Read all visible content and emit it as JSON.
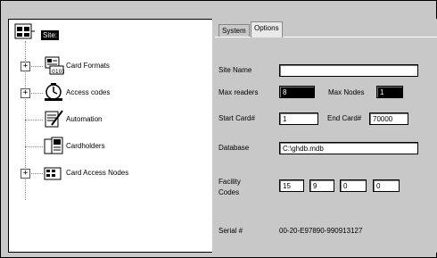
{
  "tree": {
    "root_label": "Site:",
    "items": [
      {
        "label": "Card Formats",
        "expander": "+"
      },
      {
        "label": "Access codes",
        "expander": "+"
      },
      {
        "label": "Automation",
        "expander": ""
      },
      {
        "label": "Cardholders",
        "expander": ""
      },
      {
        "label": "Card Access Nodes",
        "expander": "+"
      }
    ]
  },
  "tabs": [
    {
      "label": "System",
      "active": false
    },
    {
      "label": "Options",
      "active": true
    }
  ],
  "form": {
    "site_name_label": "Site Name",
    "site_name_value": "",
    "max_readers_label": "Max readers",
    "max_readers_value": "8",
    "max_nodes_label": "Max Nodes",
    "max_nodes_value": "1",
    "start_card_label": "Start Card#",
    "start_card_value": "1",
    "end_card_label": "End Card#",
    "end_card_value": "70000",
    "database_label": "Database",
    "database_value": "C:\\ghdb.mdb",
    "facility_label_1": "Facility",
    "facility_label_2": "Codes",
    "facility_codes": [
      "15",
      "9",
      "0",
      "0"
    ],
    "serial_label": "Serial #",
    "serial_value": "00-20-E97890-990913127"
  }
}
